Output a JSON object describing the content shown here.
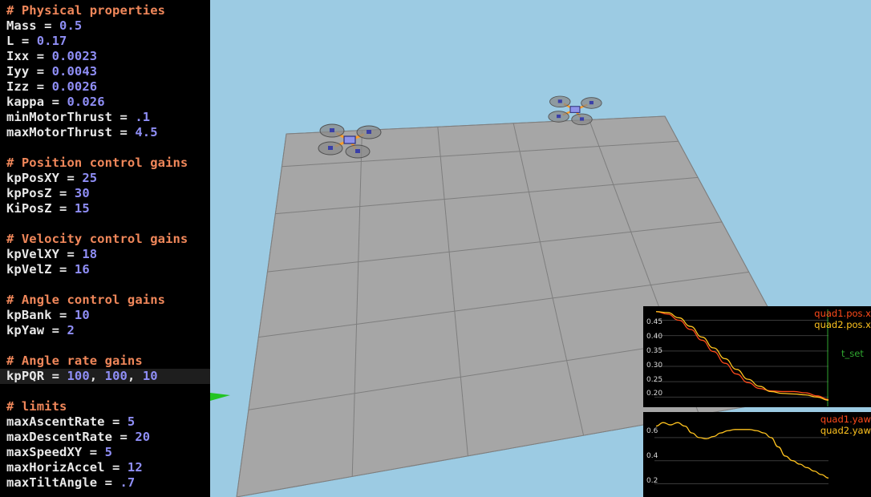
{
  "editor": {
    "lines": [
      {
        "text": "# Physical properties",
        "type": "comment"
      },
      {
        "key": "Mass",
        "value": "0.5"
      },
      {
        "key": "L",
        "value": "0.17"
      },
      {
        "key": "Ixx",
        "value": "0.0023"
      },
      {
        "key": "Iyy",
        "value": "0.0043"
      },
      {
        "key": "Izz",
        "value": "0.0026"
      },
      {
        "key": "kappa",
        "value": "0.026"
      },
      {
        "key": "minMotorThrust",
        "value": ".1"
      },
      {
        "key": "maxMotorThrust",
        "value": "4.5"
      },
      {
        "type": "blank"
      },
      {
        "text": "# Position control gains",
        "type": "comment"
      },
      {
        "key": "kpPosXY",
        "value": "25"
      },
      {
        "key": "kpPosZ",
        "value": "30"
      },
      {
        "key": "KiPosZ",
        "value": "15"
      },
      {
        "type": "blank"
      },
      {
        "text": "# Velocity control gains",
        "type": "comment"
      },
      {
        "key": "kpVelXY",
        "value": "18"
      },
      {
        "key": "kpVelZ",
        "value": "16"
      },
      {
        "type": "blank"
      },
      {
        "text": "# Angle control gains",
        "type": "comment"
      },
      {
        "key": "kpBank",
        "value": "10"
      },
      {
        "key": "kpYaw",
        "value": "2"
      },
      {
        "type": "blank"
      },
      {
        "text": "# Angle rate gains",
        "type": "comment"
      },
      {
        "key": "kpPQR",
        "values": [
          "100",
          "100",
          "10"
        ],
        "active": true
      },
      {
        "type": "blank"
      },
      {
        "text": "# limits",
        "type": "comment"
      },
      {
        "key": "maxAscentRate",
        "value": "5"
      },
      {
        "key": "maxDescentRate",
        "value": "20"
      },
      {
        "key": "maxSpeedXY",
        "value": "5"
      },
      {
        "key": "maxHorizAccel",
        "value": "12"
      },
      {
        "key": "maxTiltAngle",
        "value": ".7"
      }
    ],
    "colors": {
      "comment": "#f0875a",
      "value": "#8f8ef6",
      "text": "#e8e8e8",
      "background": "#000000"
    }
  },
  "scene": {
    "sky_color": "#9ccbe3",
    "floor_color": "#a6a6a6",
    "grid_color": "#7c7c7c",
    "quads": [
      {
        "label": "quad1",
        "arm_color": "#ff9d28"
      },
      {
        "label": "quad2",
        "arm_color": "#ff9d28"
      }
    ]
  },
  "plot_pos": {
    "ticks": [
      "0.45",
      "0.40",
      "0.35",
      "0.30",
      "0.25",
      "0.20"
    ],
    "legend": [
      {
        "label": "quad1.pos.x",
        "color": "#ff4a1a"
      },
      {
        "label": "quad2.pos.x",
        "color": "#ffc31e"
      }
    ],
    "marker_label": "t_set",
    "marker_color": "#2fa62f",
    "chart_data": {
      "type": "line",
      "ylim": [
        0.18,
        0.48
      ],
      "series": [
        {
          "name": "quad1.pos.x",
          "values": [
            0.478,
            0.47,
            0.45,
            0.42,
            0.385,
            0.348,
            0.31,
            0.275,
            0.247,
            0.228,
            0.22,
            0.218,
            0.218,
            0.214,
            0.204,
            0.192
          ]
        },
        {
          "name": "quad2.pos.x",
          "values": [
            0.478,
            0.475,
            0.458,
            0.43,
            0.395,
            0.36,
            0.325,
            0.29,
            0.258,
            0.235,
            0.218,
            0.212,
            0.21,
            0.207,
            0.2,
            0.19
          ]
        }
      ]
    }
  },
  "plot_yaw": {
    "ticks": [
      "0.6",
      "0.4",
      "0.2"
    ],
    "legend": [
      {
        "label": "quad1.yaw",
        "color": "#ff4a1a"
      },
      {
        "label": "quad2.yaw",
        "color": "#ffc31e"
      }
    ],
    "chart_data": {
      "type": "line",
      "ylim": [
        0.12,
        0.78
      ],
      "series": [
        {
          "name": "quad1.yaw",
          "values": []
        },
        {
          "name": "quad2.yaw",
          "values": [
            0.7,
            0.73,
            0.71,
            0.73,
            0.7,
            0.64,
            0.6,
            0.59,
            0.61,
            0.64,
            0.66,
            0.67,
            0.67,
            0.67,
            0.66,
            0.64,
            0.6,
            0.52,
            0.44,
            0.4,
            0.37,
            0.34,
            0.31,
            0.28,
            0.25
          ]
        }
      ]
    }
  }
}
